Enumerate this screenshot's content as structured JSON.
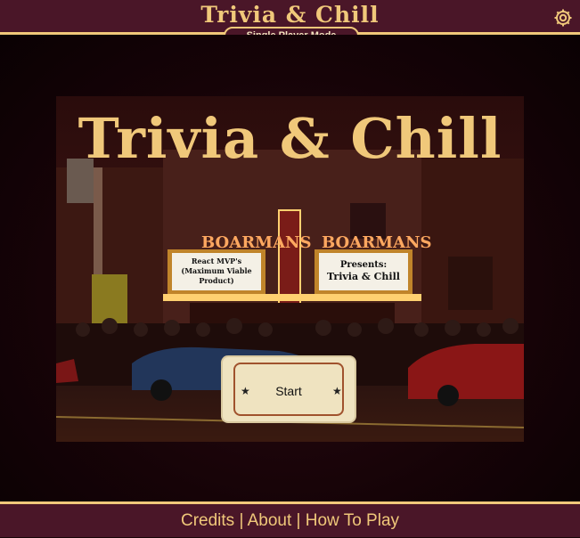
{
  "header": {
    "title": "Trivia & Chill",
    "mode": "Single Player Mode",
    "settings_icon": "gear-icon"
  },
  "hero": {
    "title": "Trivia & Chill",
    "marquee_left_sign": "BOARMANS",
    "marquee_right_sign": "BOARMANS",
    "marquee_left_board": [
      "React MVP's",
      "(Maximum Viable",
      "Product)"
    ],
    "marquee_right_board": [
      "Presents:",
      "Trivia & Chill"
    ]
  },
  "start_button": {
    "label": "Start",
    "star": "★"
  },
  "footer": {
    "links": [
      "Credits",
      "About",
      "How To Play"
    ],
    "separator": "|"
  },
  "colors": {
    "accent": "#f0c87a",
    "header_bg": "#4a1628",
    "ticket_bg": "#efe3c0",
    "ticket_border": "#a0522d"
  }
}
